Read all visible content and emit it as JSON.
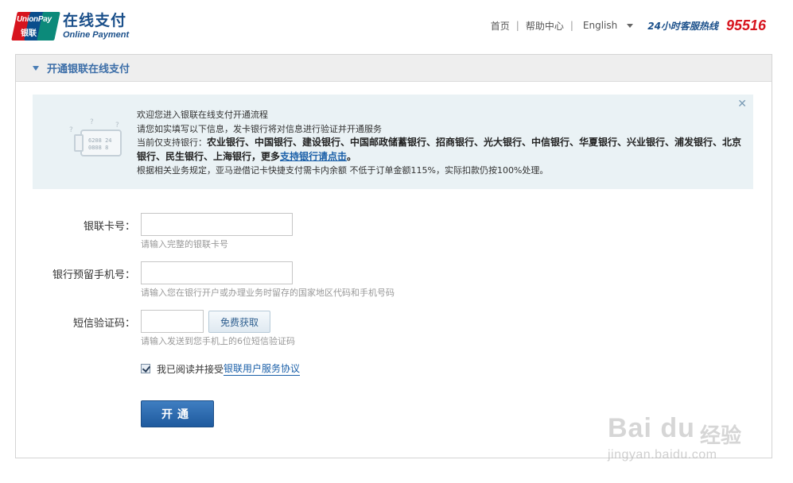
{
  "header": {
    "logo": {
      "mark_top": "UnionPay",
      "mark_bottom": "银联",
      "title_cn": "在线支付",
      "title_en": "Online Payment"
    },
    "nav": {
      "home": "首页",
      "help": "帮助中心",
      "language": "English",
      "hotline_label": "24小时客服热线",
      "hotline_number": "95516"
    }
  },
  "panel": {
    "title": "开通银联在线支付",
    "notice": {
      "line1": "欢迎您进入银联在线支付开通流程",
      "line2": "请您如实填写以下信息，发卡银行将对信息进行验证并开通服务",
      "line3_prefix": "当前仅支持银行：",
      "banks": "农业银行、中国银行、建设银行、中国邮政储蓄银行、招商银行、光大银行、中信银行、华夏银行、兴业银行、浦发银行、北京银行、民生银行、上海银行，更多",
      "more_link": "支持银行请点击",
      "banks_end": "。",
      "line4": "根据相关业务规定，亚马逊借记卡快捷支付需卡内余额 不低于订单金额115%，实际扣款仍按100%处理。",
      "card_number": "6208 24",
      "card_number2": "0808 8",
      "close_icon": "close-icon"
    },
    "form": {
      "card_label": "银联卡号：",
      "card_value": "",
      "card_hint": "请输入完整的银联卡号",
      "phone_label": "银行预留手机号：",
      "phone_value": "",
      "phone_hint": "请输入您在银行开户或办理业务时留存的国家地区代码和手机号码",
      "sms_label": "短信验证码：",
      "sms_value": "",
      "sms_button": "免费获取",
      "sms_hint": "请输入发送到您手机上的6位短信验证码",
      "agree_text": "我已阅读并接受",
      "agree_link": "银联用户服务协议",
      "agree_checked": true,
      "submit": "开通"
    }
  },
  "watermark": {
    "brand": "Bai du",
    "brand_cn": "经验",
    "url": "jingyan.baidu.com"
  },
  "colors": {
    "brand_blue": "#1a4f8a",
    "brand_red": "#d7141e",
    "link_blue": "#1a5fa8",
    "notice_bg": "#eaf2f5",
    "submit_bg": "#2a6aae"
  }
}
